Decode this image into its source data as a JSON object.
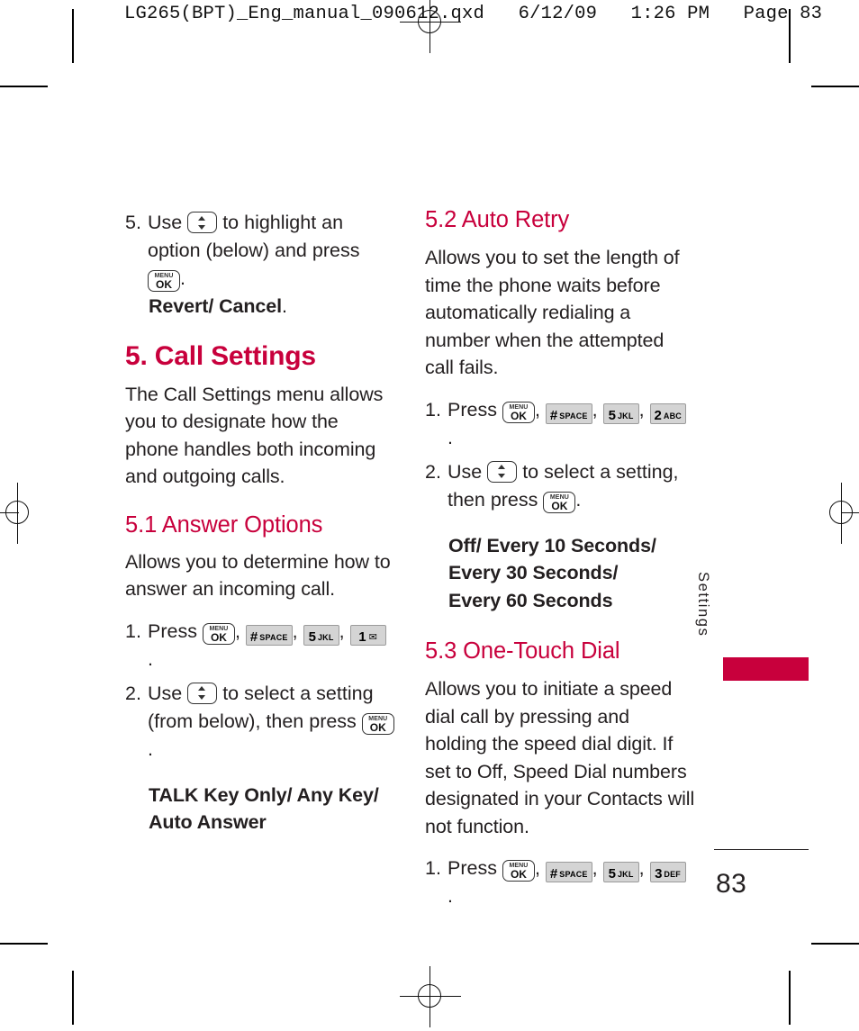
{
  "proof_header": "LG265(BPT)_Eng_manual_090612.qxd   6/12/09   1:26 PM   Page 83",
  "colors": {
    "brand_crimson": "#c8003c",
    "body_text": "#231f20",
    "key_fill": "#d4d4d4",
    "key_border": "#9b9b9b"
  },
  "side_tab": {
    "label": "Settings"
  },
  "page_number": "83",
  "left_column": {
    "step5": {
      "number": "5.",
      "text_part1": "Use",
      "text_part2": "to highlight an option (below) and press",
      "text_part3": ".",
      "options_bold": "Revert/ Cancel",
      "options_period": "."
    },
    "chapter_heading": "5. Call Settings",
    "chapter_intro": "The Call Settings menu allows you to designate how the phone handles both incoming and outgoing calls.",
    "section_5_1": {
      "heading": "5.1 Answer Options",
      "intro": "Allows you to determine how to answer an incoming call.",
      "step1": {
        "number": "1.",
        "label": "Press",
        "keys": [
          {
            "type": "ok",
            "menu": "MENU",
            "ok": "OK"
          },
          {
            "type": "pad",
            "big": "#",
            "sub": "SPACE"
          },
          {
            "type": "pad",
            "big": "5",
            "sub": "JKL"
          },
          {
            "type": "pad",
            "big": "1",
            "sub": "✉"
          }
        ],
        "separator": ",",
        "terminator": "."
      },
      "step2": {
        "number": "2.",
        "text_part1": "Use",
        "text_part2": "to select a setting (from below), then press",
        "text_part3": "."
      },
      "options": [
        "TALK Key Only/ Any Key/",
        "Auto Answer"
      ]
    }
  },
  "right_column": {
    "section_5_2": {
      "heading": "5.2 Auto Retry",
      "intro": "Allows you to set the length of time the phone waits before automatically redialing a number when the attempted call fails.",
      "step1": {
        "number": "1.",
        "label": "Press",
        "keys": [
          {
            "type": "ok",
            "menu": "MENU",
            "ok": "OK"
          },
          {
            "type": "pad",
            "big": "#",
            "sub": "SPACE"
          },
          {
            "type": "pad",
            "big": "5",
            "sub": "JKL"
          },
          {
            "type": "pad",
            "big": "2",
            "sub": "ABC"
          }
        ],
        "separator": ",",
        "terminator": "."
      },
      "step2": {
        "number": "2.",
        "text_part1": "Use",
        "text_part2": "to select a setting, then press",
        "text_part3": "."
      },
      "options": [
        "Off/ Every 10 Seconds/",
        "Every 30 Seconds/",
        "Every 60 Seconds"
      ]
    },
    "section_5_3": {
      "heading": "5.3 One-Touch Dial",
      "intro": "Allows you to initiate a speed dial call by pressing and holding the speed dial digit. If set to Off, Speed Dial numbers designated in your Contacts will not function.",
      "step1": {
        "number": "1.",
        "label": "Press",
        "keys": [
          {
            "type": "ok",
            "menu": "MENU",
            "ok": "OK"
          },
          {
            "type": "pad",
            "big": "#",
            "sub": "SPACE"
          },
          {
            "type": "pad",
            "big": "5",
            "sub": "JKL"
          },
          {
            "type": "pad",
            "big": "3",
            "sub": "DEF"
          }
        ],
        "separator": ",",
        "terminator": "."
      }
    }
  }
}
